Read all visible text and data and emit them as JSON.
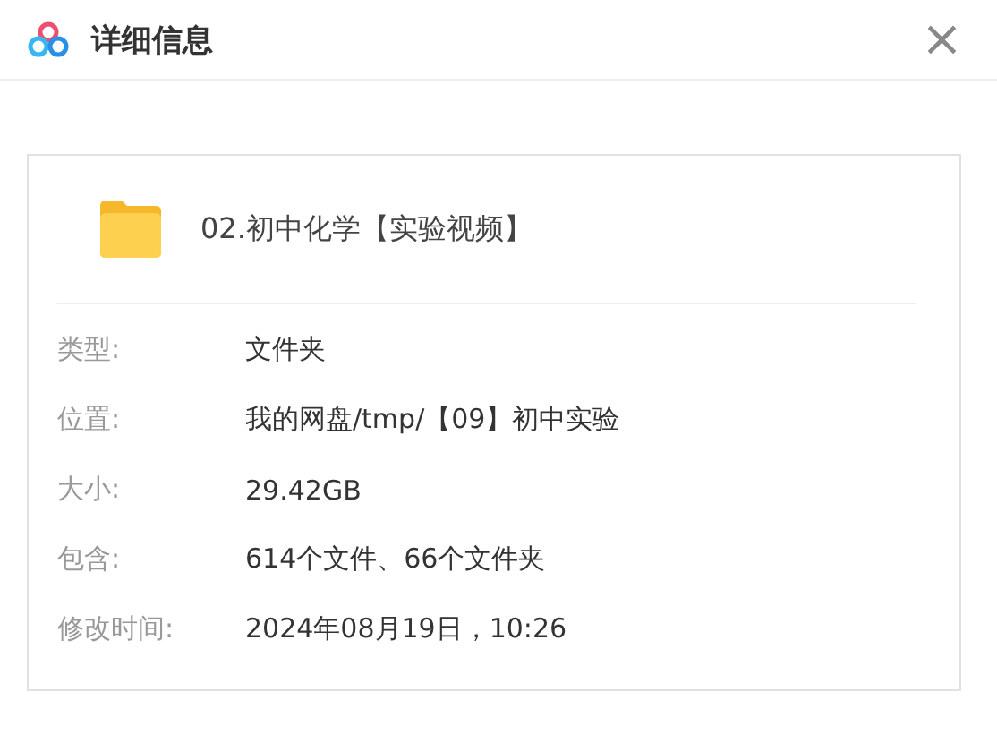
{
  "window": {
    "title": "详细信息",
    "close": "×"
  },
  "item": {
    "name": "02.初中化学【实验视频】"
  },
  "properties": [
    {
      "label": "类型:",
      "value": "文件夹"
    },
    {
      "label": "位置:",
      "value": "我的网盘/tmp/【09】初中实验"
    },
    {
      "label": "大小:",
      "value": "29.42GB"
    },
    {
      "label": "包含:",
      "value": "614个文件、66个文件夹"
    },
    {
      "label": "修改时间:",
      "value": "2024年08月19日，10:26"
    }
  ]
}
